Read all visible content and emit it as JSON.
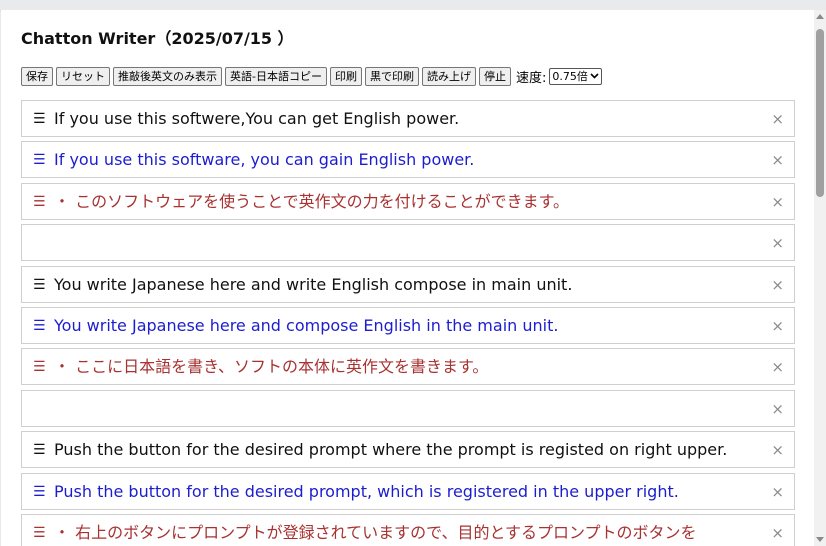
{
  "app": {
    "title": "Chatton Writer（2025/07/15 ）"
  },
  "toolbar": {
    "buttons": [
      "保存",
      "リセット",
      "推敲後英文のみ表示",
      "英語-日本語コピー",
      "印刷",
      "黒で印刷",
      "読み上げ",
      "停止"
    ],
    "speed_label": "速度:",
    "speed_value": "0.75倍"
  },
  "rows": [
    {
      "text": "If you use this softwere,You can get English power.",
      "kind": "original"
    },
    {
      "text": "If you use this software, you can gain English power.",
      "kind": "corrected"
    },
    {
      "text": "・ このソフトウェアを使うことで英作文の力を付けることができます。",
      "kind": "translation"
    },
    {
      "text": "",
      "kind": "empty"
    },
    {
      "text": "You write Japanese here and  write English compose in main unit.",
      "kind": "original"
    },
    {
      "text": "You write Japanese here and compose English in the main unit.",
      "kind": "corrected"
    },
    {
      "text": "・ ここに日本語を書き、ソフトの本体に英作文を書きます。",
      "kind": "translation"
    },
    {
      "text": "",
      "kind": "empty"
    },
    {
      "text": "Push the  button for the desired prompt where the prompt is registed on right upper.",
      "kind": "original"
    },
    {
      "text": "Push the button for the desired prompt, which is registered in the upper right.",
      "kind": "corrected"
    },
    {
      "text": "・ 右上のボタンにプロンプトが登録されていますので、目的とするプロンプトのボタンを",
      "kind": "translation"
    }
  ],
  "icons": {
    "handle": "☰",
    "close": "×"
  },
  "colors": {
    "original": "#111111",
    "corrected": "#1d1dd0",
    "translation": "#a83232"
  }
}
